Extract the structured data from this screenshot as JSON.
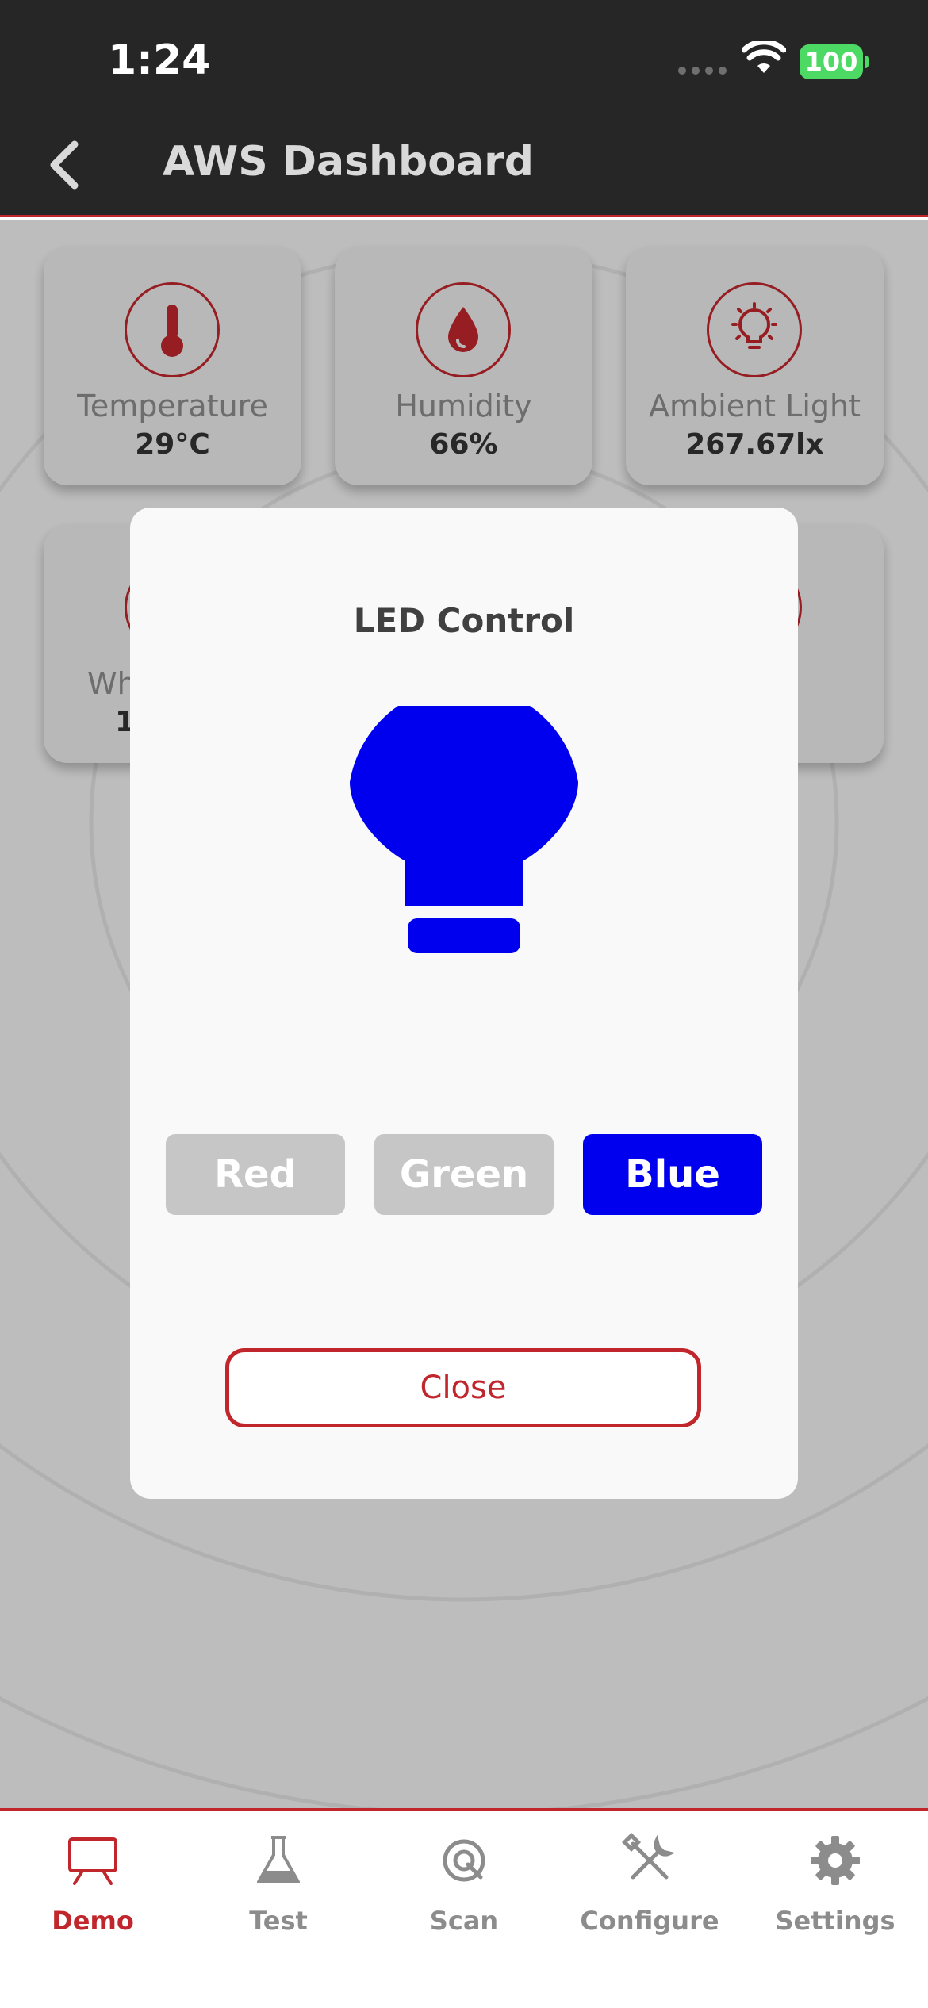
{
  "status_bar": {
    "time": "1:24",
    "battery": "100"
  },
  "header": {
    "title": "AWS Dashboard"
  },
  "tiles": [
    {
      "label": "Temperature",
      "value": "29°C",
      "icon": "thermometer-icon"
    },
    {
      "label": "Humidity",
      "value": "66%",
      "icon": "water-drop-icon"
    },
    {
      "label": "Ambient Light",
      "value": "267.67lx",
      "icon": "lightbulb-icon"
    }
  ],
  "partial_tile": {
    "label_fragment": "Wh",
    "value_fragment": "1"
  },
  "modal": {
    "title": "LED Control",
    "bulb_color": "#0000ee",
    "buttons": [
      {
        "label": "Red",
        "color": "#c6c6c6"
      },
      {
        "label": "Green",
        "color": "#c6c6c6"
      },
      {
        "label": "Blue",
        "color": "#0000ee"
      }
    ],
    "selected": "Blue",
    "close_label": "Close"
  },
  "tabs": [
    {
      "label": "Demo",
      "icon": "presentation-board-icon",
      "active": true
    },
    {
      "label": "Test",
      "icon": "flask-icon",
      "active": false
    },
    {
      "label": "Scan",
      "icon": "scan-target-icon",
      "active": false
    },
    {
      "label": "Configure",
      "icon": "tools-icon",
      "active": false
    },
    {
      "label": "Settings",
      "icon": "gear-icon",
      "active": false
    }
  ],
  "colors": {
    "accent": "#c0262c",
    "header_bg": "#262626",
    "battery": "#4cd964"
  }
}
